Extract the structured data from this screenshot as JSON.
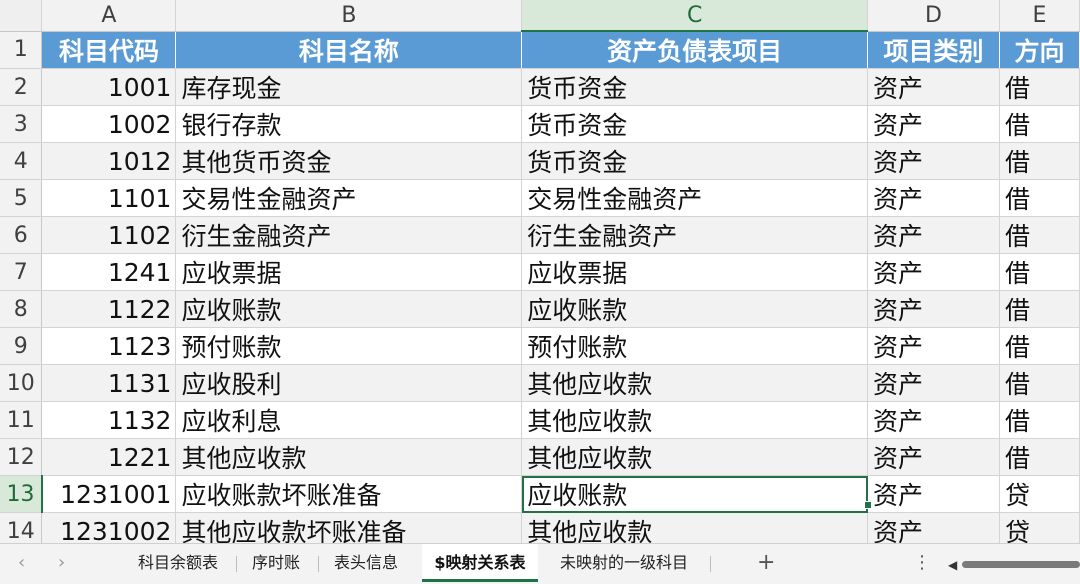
{
  "columns": [
    "A",
    "B",
    "C",
    "D",
    "E"
  ],
  "header": [
    "科目代码",
    "科目名称",
    "资产负债表项目",
    "项目类别",
    "方向"
  ],
  "rows": [
    {
      "num": "2",
      "code": "1001",
      "name": "库存现金",
      "item": "货币资金",
      "cat": "资产",
      "dir": "借"
    },
    {
      "num": "3",
      "code": "1002",
      "name": "银行存款",
      "item": "货币资金",
      "cat": "资产",
      "dir": "借"
    },
    {
      "num": "4",
      "code": "1012",
      "name": "其他货币资金",
      "item": "货币资金",
      "cat": "资产",
      "dir": "借"
    },
    {
      "num": "5",
      "code": "1101",
      "name": "交易性金融资产",
      "item": "交易性金融资产",
      "cat": "资产",
      "dir": "借"
    },
    {
      "num": "6",
      "code": "1102",
      "name": "衍生金融资产",
      "item": "衍生金融资产",
      "cat": "资产",
      "dir": "借"
    },
    {
      "num": "7",
      "code": "1241",
      "name": "应收票据",
      "item": "应收票据",
      "cat": "资产",
      "dir": "借"
    },
    {
      "num": "8",
      "code": "1122",
      "name": "应收账款",
      "item": "应收账款",
      "cat": "资产",
      "dir": "借"
    },
    {
      "num": "9",
      "code": "1123",
      "name": "预付账款",
      "item": "预付账款",
      "cat": "资产",
      "dir": "借"
    },
    {
      "num": "10",
      "code": "1131",
      "name": "应收股利",
      "item": "其他应收款",
      "cat": "资产",
      "dir": "借"
    },
    {
      "num": "11",
      "code": "1132",
      "name": "应收利息",
      "item": "其他应收款",
      "cat": "资产",
      "dir": "借"
    },
    {
      "num": "12",
      "code": "1221",
      "name": "其他应收款",
      "item": "其他应收款",
      "cat": "资产",
      "dir": "借"
    },
    {
      "num": "13",
      "code": "1231001",
      "name": "应收账款坏账准备",
      "item": "应收账款",
      "cat": "资产",
      "dir": "贷"
    },
    {
      "num": "14",
      "code": "1231002",
      "name": "其他应收款坏账准备",
      "item": "其他应收款",
      "cat": "资产",
      "dir": "贷"
    }
  ],
  "header_row_num": "1",
  "tabs": {
    "prev": "‹",
    "next": "›",
    "t1": "科目余额表",
    "t2": "序时账",
    "t3": "表头信息",
    "t4": "$映射关系表",
    "t5": "未映射的一级科目",
    "add": "+",
    "more": "⋮"
  },
  "colors": {
    "header_fill": "#5b9bd5",
    "accent": "#217346"
  }
}
